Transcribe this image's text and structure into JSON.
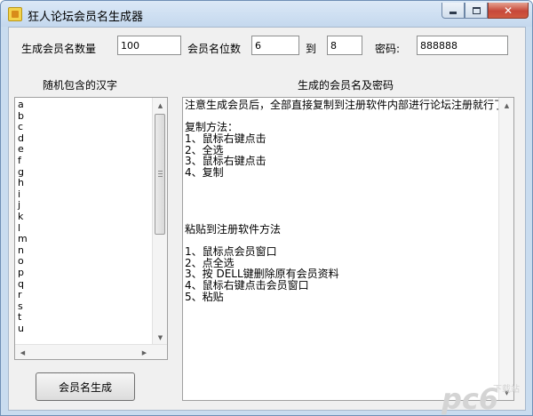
{
  "window": {
    "title": "狂人论坛会员名生成器"
  },
  "form": {
    "count_label": "生成会员名数量",
    "count_value": "100",
    "digits_label": "会员名位数",
    "digits_min": "6",
    "to_label": "到",
    "digits_max": "8",
    "password_label": "密码:",
    "password_value": "888888"
  },
  "chars_panel": {
    "heading": "随机包含的汉字",
    "items": [
      "a",
      "b",
      "c",
      "d",
      "e",
      "f",
      "g",
      "h",
      "i",
      "j",
      "k",
      "l",
      "m",
      "n",
      "o",
      "p",
      "q",
      "r",
      "s",
      "t",
      "u"
    ]
  },
  "output_panel": {
    "heading": "生成的会员名及密码",
    "lines": [
      "注意生成会员后，全部直接复制到注册软件内部进行论坛注册就行了",
      "",
      "复制方法：",
      "1、鼠标右键点击",
      "2、全选",
      "3、鼠标右键点击",
      "4、复制",
      "",
      "",
      "",
      "",
      "粘贴到注册软件方法",
      "",
      "1、鼠标点会员窗口",
      "2、点全选",
      "3、按 DELL键删除原有会员资料",
      "4、鼠标右键点击会员窗口",
      "5、粘贴"
    ]
  },
  "generate_button": {
    "label": "会员名生成"
  },
  "watermark": {
    "text": "pc6",
    "subtext": "下载站"
  },
  "colors": {
    "title_bar": "#c4d8ee",
    "close_button": "#c7483a",
    "dialog_bg": "#f0f0f0",
    "watermark": "#c7c7c7"
  }
}
